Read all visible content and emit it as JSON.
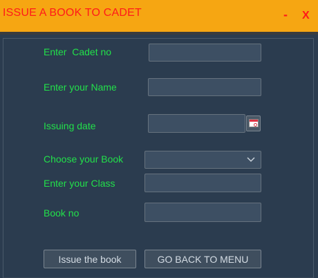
{
  "window": {
    "title": "ISSUE A BOOK TO CADET",
    "minimize_label": "-",
    "close_label": "X"
  },
  "form": {
    "cadet_no_label": "Enter  Cadet no",
    "cadet_no_value": "",
    "name_label": "Enter your Name",
    "name_value": "",
    "issuing_date_label": "Issuing date",
    "issuing_date_value": "",
    "book_label": "Choose your Book",
    "book_selected": "",
    "class_label": "Enter your Class",
    "class_value": "",
    "book_no_label": "Book no",
    "book_no_value": ""
  },
  "actions": {
    "issue_label": "Issue the book",
    "back_label": "GO BACK TO MENU"
  },
  "colors": {
    "titlebar": "#f6a612",
    "title_text": "#ff1a1a",
    "label_text": "#22e04a",
    "panel": "#2b3c4f"
  },
  "icons": {
    "date_picker": "calendar-icon",
    "dropdown": "chevron-down-icon"
  }
}
